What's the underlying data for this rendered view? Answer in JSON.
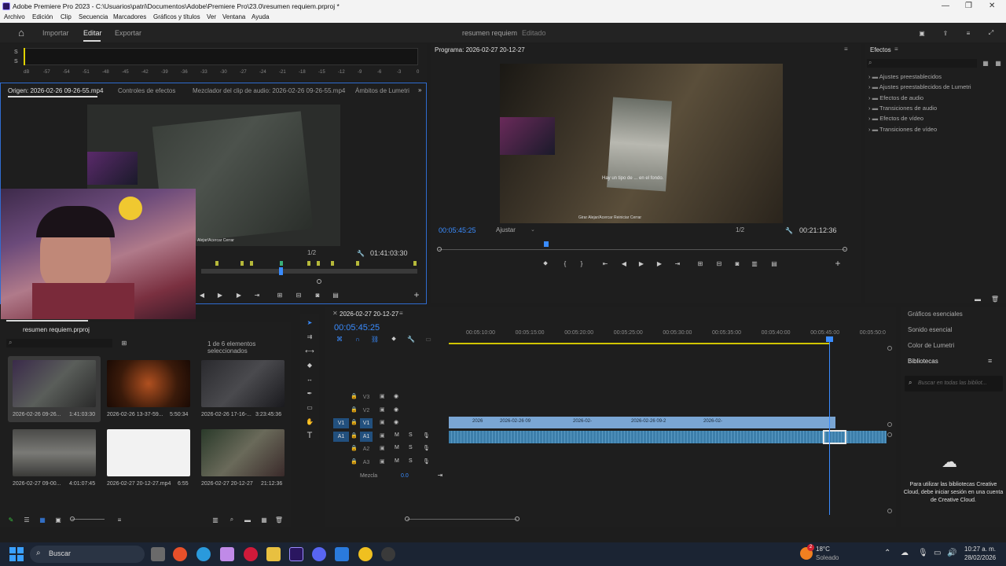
{
  "window": {
    "title": "Adobe Premiere Pro 2023 - C:\\Usuarios\\patri\\Documentos\\Adobe\\Premiere Pro\\23.0\\resumen requiem.prproj *"
  },
  "menu": [
    "Archivo",
    "Edición",
    "Clip",
    "Secuencia",
    "Marcadores",
    "Gráficos y títulos",
    "Ver",
    "Ventana",
    "Ayuda"
  ],
  "appbar": {
    "tabs": [
      "Importar",
      "Editar",
      "Exportar"
    ],
    "project_name": "resumen requiem",
    "project_status": "Editado"
  },
  "audio_meter": {
    "labels": [
      "dB",
      "-57",
      "-54",
      "-51",
      "-48",
      "-45",
      "-42",
      "-39",
      "-36",
      "-33",
      "-30",
      "-27",
      "-24",
      "-21",
      "-18",
      "-15",
      "-12",
      "-9",
      "-6",
      "-3",
      "0"
    ],
    "channels": [
      "S",
      "S"
    ]
  },
  "source_monitor": {
    "tabs": [
      "Origen: 2026-02-26 09-26-55.mp4",
      "Controles de efectos",
      "Mezclador del clip de audio: 2026-02-26 09-26-55.mp4",
      "Ámbitos de Lumetri"
    ],
    "fraction": "1/2",
    "duration": "01:41:03:30",
    "hud_text": "Alejar/Acercar   Cerrar"
  },
  "program_monitor": {
    "title": "Programa: 2026-02-27 20-12-27",
    "timecode": "00:05:45:25",
    "fit": "Ajustar",
    "fraction": "1/2",
    "duration": "00:21:12:36",
    "subtitle": "Hay un tipo de ... en el fondo.",
    "hud": "Girar   Alejar/Acercar   Reiniciar   Cerrar"
  },
  "effects": {
    "title": "Efectos",
    "items": [
      "Ajustes preestablecidos",
      "Ajustes preestablecidos de Lumetri",
      "Efectos de audio",
      "Transiciones de audio",
      "Efectos de vídeo",
      "Transiciones de vídeo"
    ]
  },
  "project": {
    "title": "resumen requiem.prproj",
    "selection": "1 de 6 elementos seleccionados",
    "items": [
      {
        "name": "2026-02-26 09-26...",
        "duration": "1:41:03:30"
      },
      {
        "name": "2026-02-26 13-37-59...",
        "duration": "5:50:34"
      },
      {
        "name": "2026-02-26 17-16-...",
        "duration": "3:23:45:36"
      },
      {
        "name": "2026-02-27 09-00...",
        "duration": "4:01:07:45"
      },
      {
        "name": "2026-02-27 20-12-27.mp4",
        "duration": "6:55"
      },
      {
        "name": "2026-02-27 20-12-27",
        "duration": "21:12:36"
      }
    ]
  },
  "timeline": {
    "sequence": "2026-02-27 20-12-27",
    "timecode": "00:05:45:25",
    "ruler": [
      "00:05:10:00",
      "00:05:15:00",
      "00:05:20:00",
      "00:05:25:00",
      "00:05:30:00",
      "00:05:35:00",
      "00:05:40:00",
      "00:05:45:00",
      "00:05:50:0"
    ],
    "tracks": [
      "V3",
      "V2",
      "V1",
      "A1",
      "A2",
      "A3"
    ],
    "mix_label": "Mezcla",
    "mix_value": "0.0",
    "clip_labels": [
      "2026",
      "2026-02-26 09",
      "2026-02-",
      "2026-02-26 09-2",
      "2026-02-"
    ]
  },
  "right_panel": {
    "items": [
      "Gráficos esenciales",
      "Sonido esencial",
      "Color de Lumetri",
      "Bibliotecas"
    ],
    "search_placeholder": "Buscar en todas las bibliot...",
    "cc_message": "Para utilizar las bibliotecas Creative Cloud, debe iniciar sesión en una cuenta de Creative Cloud."
  },
  "taskbar": {
    "search": "Buscar",
    "weather_temp": "18°C",
    "weather_desc": "Soleado",
    "weather_badge": "2",
    "time": "10:27 a. m.",
    "date": "28/02/2026"
  }
}
